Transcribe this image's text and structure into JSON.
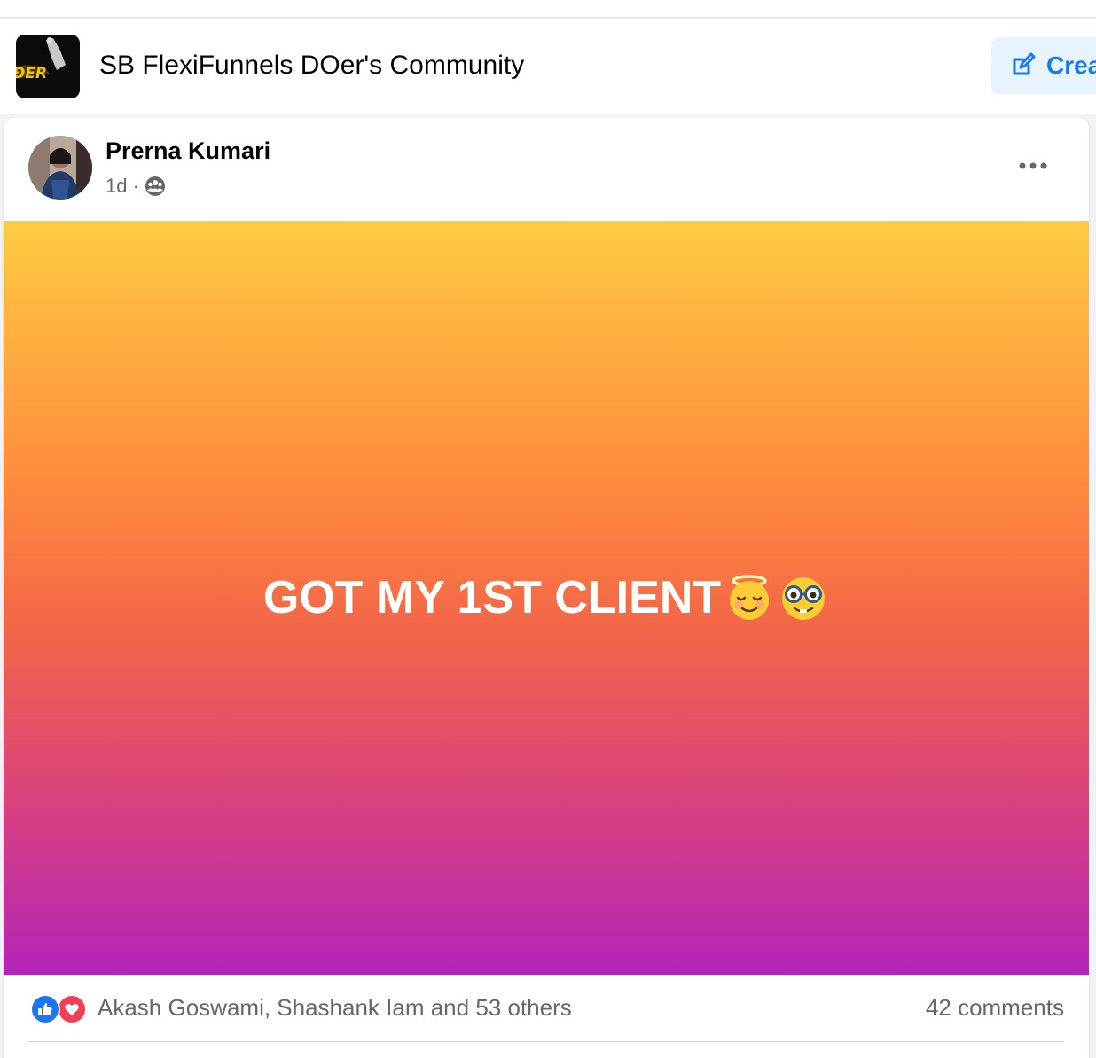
{
  "group": {
    "name": "SB FlexiFunnels DOer's Community",
    "create_label": "Crea"
  },
  "post": {
    "author": "Prerna Kumari",
    "time": "1d",
    "separator": "·",
    "privacy_icon": "group-members-icon",
    "text": "GOT MY 1ST CLIENT",
    "emojis": [
      "smiling-face-with-halo-icon",
      "nerd-face-icon"
    ],
    "gradient": [
      "#fdcc42",
      "#ff8a3d",
      "#f26449",
      "#d43d86",
      "#b424b8"
    ]
  },
  "reactions": {
    "icons": [
      "like-icon",
      "love-icon"
    ],
    "names": "Akash Goswami, Shashank Iam and 53 others",
    "comments": "42 comments"
  },
  "colors": {
    "accent": "#1877f2",
    "accent_bg": "#e7f3ff",
    "love": "#f33e58",
    "secondary_text": "#65676b"
  }
}
